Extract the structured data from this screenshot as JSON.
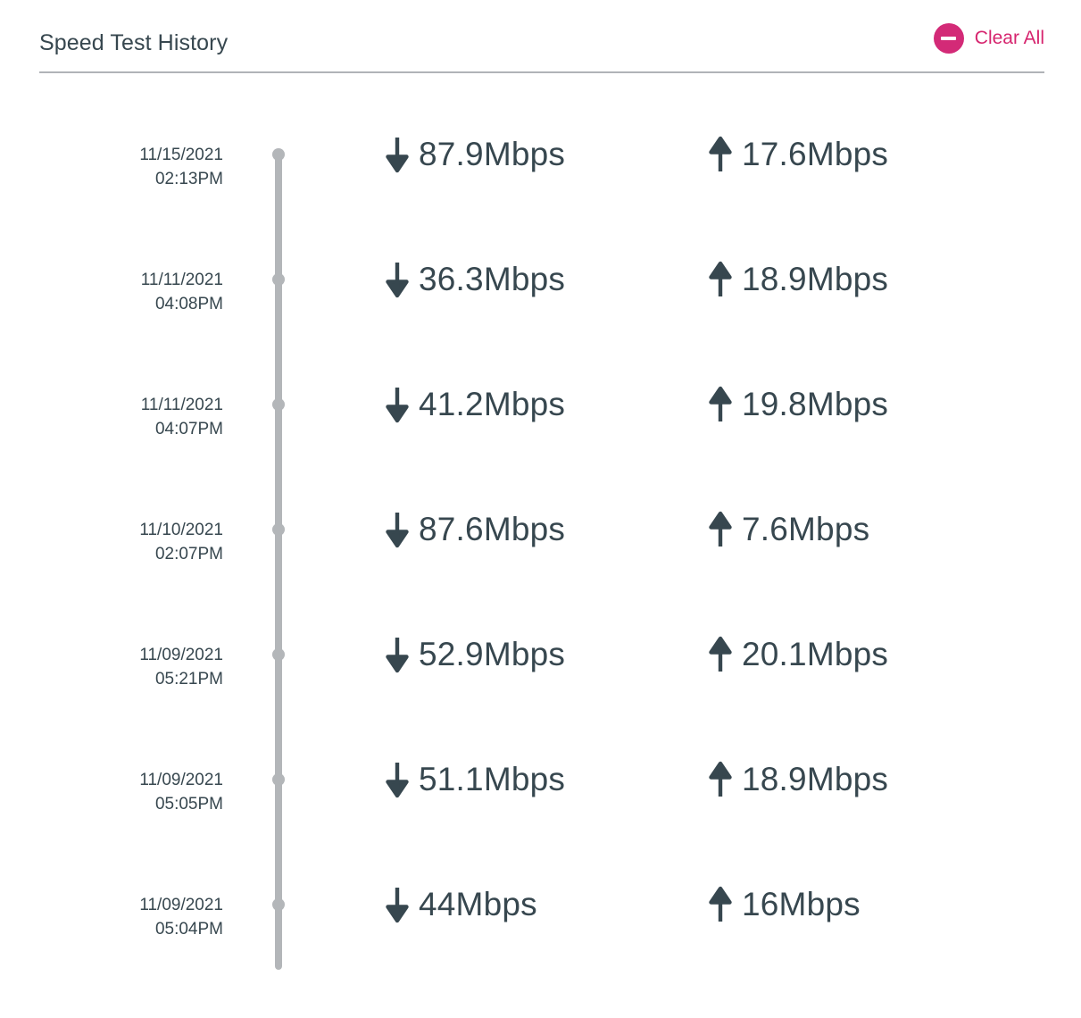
{
  "header": {
    "title": "Speed Test History",
    "clear_all_label": "Clear All",
    "clear_all_icon": "minus-circle-icon",
    "accent_color": "#d6246e",
    "icon_color": "#d32a77",
    "text_color": "#37474f",
    "divider_color": "#b0b3b8"
  },
  "timeline": {
    "line_color": "#b3b6b9",
    "dot_color": "#b3b6b9",
    "download_icon": "arrow-down-icon",
    "upload_icon": "arrow-up-icon",
    "unit": "Mbps",
    "entries": [
      {
        "date": "11/15/2021",
        "time": "02:13PM",
        "download": "87.9Mbps",
        "upload": "17.6Mbps"
      },
      {
        "date": "11/11/2021",
        "time": "04:08PM",
        "download": "36.3Mbps",
        "upload": "18.9Mbps"
      },
      {
        "date": "11/11/2021",
        "time": "04:07PM",
        "download": "41.2Mbps",
        "upload": "19.8Mbps"
      },
      {
        "date": "11/10/2021",
        "time": "02:07PM",
        "download": "87.6Mbps",
        "upload": "7.6Mbps"
      },
      {
        "date": "11/09/2021",
        "time": "05:21PM",
        "download": "52.9Mbps",
        "upload": "20.1Mbps"
      },
      {
        "date": "11/09/2021",
        "time": "05:05PM",
        "download": "51.1Mbps",
        "upload": "18.9Mbps"
      },
      {
        "date": "11/09/2021",
        "time": "05:04PM",
        "download": "44Mbps",
        "upload": "16Mbps"
      }
    ]
  }
}
